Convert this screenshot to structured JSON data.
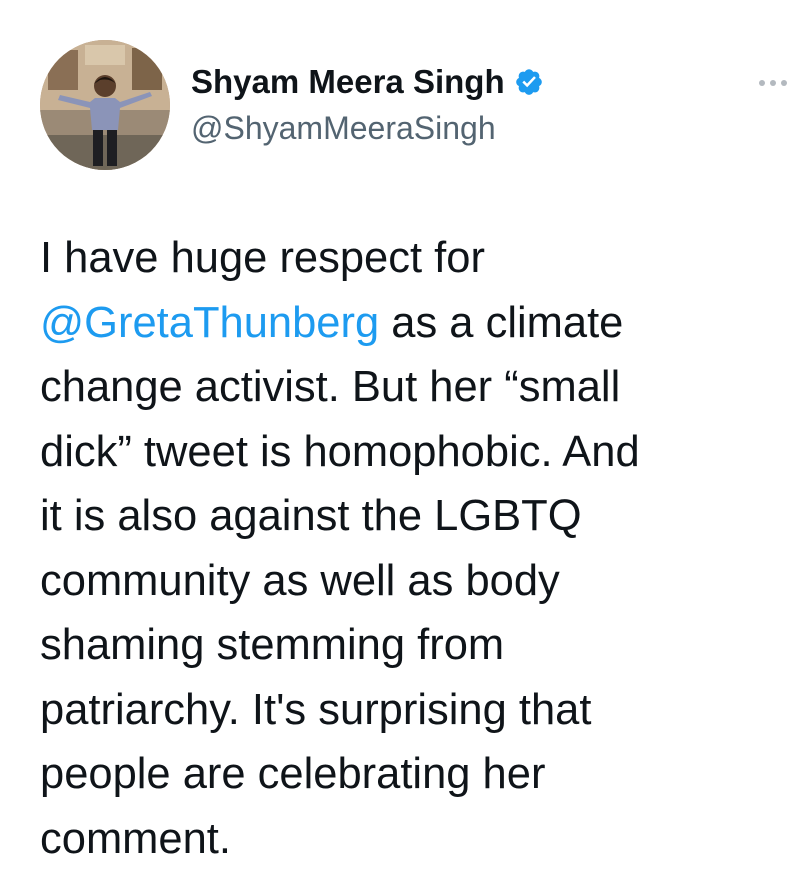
{
  "author": {
    "display_name": "Shyam Meera Singh",
    "handle": "@ShyamMeeraSingh",
    "verified": true,
    "verified_color": "#1d9bf0",
    "avatar_icon": "profile-photo"
  },
  "more_icon": "ellipsis-icon",
  "tweet": {
    "lines": [
      [
        {
          "text": "I have huge respect for"
        }
      ],
      [
        {
          "text": "@GretaThunberg",
          "mention": true
        },
        {
          "text": " as a climate"
        }
      ],
      [
        {
          "text": "change activist. But her “small"
        }
      ],
      [
        {
          "text": "dick” tweet is homophobic. And"
        }
      ],
      [
        {
          "text": "it is also against the LGBTQ"
        }
      ],
      [
        {
          "text": "community as well as body"
        }
      ],
      [
        {
          "text": "shaming stemming from"
        }
      ],
      [
        {
          "text": "patriarchy.  It's surprising that"
        }
      ],
      [
        {
          "text": "people are celebrating her"
        }
      ],
      [
        {
          "text": "comment."
        }
      ]
    ]
  },
  "colors": {
    "text": "#0f1419",
    "secondary": "#536471",
    "link": "#1d9bf0"
  }
}
